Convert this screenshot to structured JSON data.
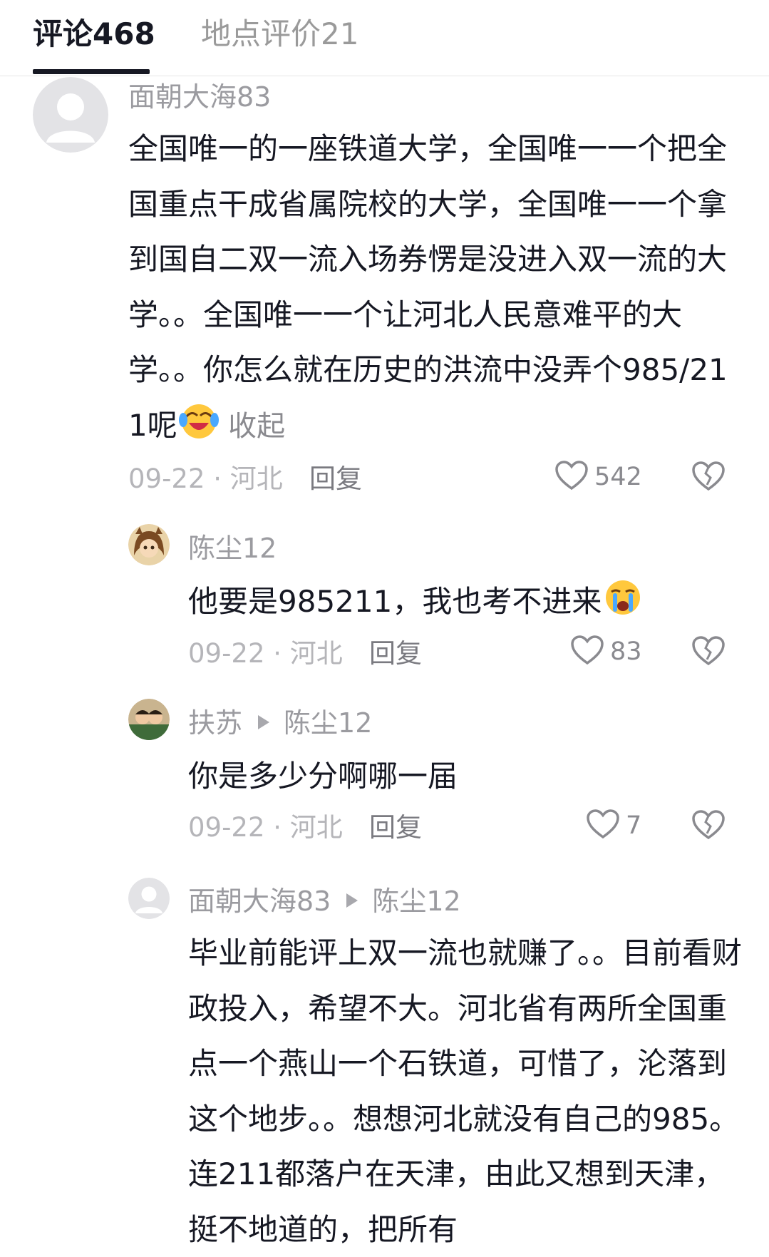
{
  "tabs": {
    "comments_label": "评论468",
    "place_reviews_label": "地点评价21"
  },
  "comments": [
    {
      "username": "面朝大海83",
      "text": "全国唯一的一座铁道大学，全国唯一一个把全国重点干成省属院校的大学，全国唯一一个拿到国自二双一流入场券愣是没进入双一流的大学。。全国唯一一个让河北人民意难平的大学。。你怎么就在历史的洪流中没弄个985/211呢",
      "collapse_label": "收起",
      "meta": "09-22 · 河北",
      "reply_label": "回复",
      "likes": "542"
    },
    {
      "username": "陈尘12",
      "text": "他要是985211，我也考不进来",
      "meta": "09-22 · 河北",
      "reply_label": "回复",
      "likes": "83"
    },
    {
      "username": "扶苏",
      "reply_to": "陈尘12",
      "text": "你是多少分啊哪一届",
      "meta": "09-22 · 河北",
      "reply_label": "回复",
      "likes": "7"
    },
    {
      "username": "面朝大海83",
      "reply_to": "陈尘12",
      "text": "毕业前能评上双一流也就赚了。。目前看财政投入，希望不大。河北省有两所全国重点一个燕山一个石铁道，可惜了，沦落到这个地步。。想想河北就没有自己的985。连211都落户在天津，由此又想到天津，挺不地道的，把所有"
    }
  ],
  "icons": {
    "like": "heart-outline-icon",
    "dislike": "broken-heart-icon",
    "default_avatar": "default-avatar-icon",
    "emoji_laugh": "laughing-tears-emoji",
    "emoji_cry": "crying-emoji",
    "reply_arrow": "play-triangle-icon"
  }
}
